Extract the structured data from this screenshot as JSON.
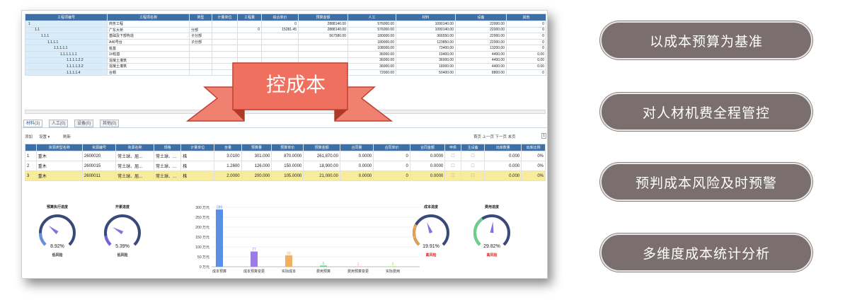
{
  "tree_table": {
    "headers": [
      "工程项编号",
      "工程项名称",
      "类型",
      "计量单位",
      "工程量",
      "综合单价",
      "预算金额",
      "人工",
      "材料",
      "设备",
      "其他"
    ],
    "rows": [
      {
        "code": "1",
        "name": "商务工程",
        "type": "",
        "unit": "",
        "qty": "",
        "price": "0",
        "budget": "2888140.00",
        "labor": "576000.00",
        "material": "1090140.00",
        "equip": "22000.00",
        "other": "0"
      },
      {
        "code": "1.1",
        "name": "广东大桥",
        "type": "分部",
        "unit": "",
        "qty": "0",
        "price": "15281.45",
        "budget": "2888140.00",
        "labor": "576000.00",
        "material": "1090140.00",
        "equip": "22000.00",
        "other": "0"
      },
      {
        "code": "1.1.1",
        "name": "基础及下部构造",
        "type": "子分部",
        "unit": "",
        "qty": "",
        "price": "",
        "budget": "567580.00",
        "labor": "180000.00",
        "material": "366550.00",
        "equip": "22000.00",
        "other": "0"
      },
      {
        "code": "1.1.1.1",
        "name": "A40号台",
        "type": "子分部",
        "unit": "",
        "qty": "",
        "price": "",
        "budget": "",
        "labor": "180000.00",
        "material": "123850.00",
        "equip": "22000.00",
        "other": "0"
      },
      {
        "code": "1.1.1.1.1",
        "name": "桩基",
        "type": "",
        "unit": "",
        "qty": "",
        "price": "",
        "budget": "",
        "labor": "108000.00",
        "material": "73400.00",
        "equip": "13200.00",
        "other": "0"
      },
      {
        "code": "1.1.1.1.1.1",
        "name": "1#桩基",
        "type": "",
        "unit": "",
        "qty": "",
        "price": "",
        "budget": "",
        "labor": "36000.00",
        "material": "19400.00",
        "equip": "4400.00",
        "other": "0.00"
      },
      {
        "code": "1.1.1.1.2.2",
        "name": "混凝土灌筑",
        "type": "",
        "unit": "",
        "qty": "",
        "price": "",
        "budget": "",
        "labor": "36000.00",
        "material": "36000.00",
        "equip": "4400.00",
        "other": "0.00"
      },
      {
        "code": "1.1.1.1.3.2",
        "name": "混凝土灌筑",
        "type": "",
        "unit": "",
        "qty": "",
        "price": "",
        "budget": "",
        "labor": "36000.00",
        "material": "18000.00",
        "equip": "4400.00",
        "other": "0.00"
      },
      {
        "code": "1.1.1.1.4",
        "name": "台帽",
        "type": "",
        "unit": "",
        "qty": "0",
        "price": "1312.",
        "budget": "",
        "labor": "72000.00",
        "material": "50400.00",
        "equip": "8800.00",
        "other": "0"
      }
    ]
  },
  "banner_text": "控成本",
  "tabs": [
    "材料(3)",
    "人工(0)",
    "设备(0)",
    "其他(0)"
  ],
  "toolbar": {
    "add": "添加",
    "settings": "设置 ▾",
    "refresh": "刷新",
    "pager": "首页 上一页 下一页 末页",
    "page": "1"
  },
  "resource_table": {
    "headers": [
      "",
      "资源类型名称",
      "资源编号",
      "资源名称",
      "规格",
      "计量单位",
      "含量",
      "预算量",
      "预算单价",
      "预算金额",
      "合同量",
      "合同单价",
      "合同金额",
      "甲供",
      "主设备",
      "出库数量",
      "出库比例"
    ],
    "rows": [
      {
        "n": "1",
        "type": "重木",
        "code": "2600020",
        "name": "常土球、屈...",
        "spec": "常土球、...",
        "unit": "株",
        "content": "3.0100",
        "qty": "301.000",
        "price": "870.0000",
        "amount": "261,870.00",
        "cqty": "0.0000",
        "cprice": "0",
        "camount": "0.0000",
        "out": "0.000",
        "ratio": "0%"
      },
      {
        "n": "2",
        "type": "重木",
        "code": "2600015",
        "name": "常土球、屈...",
        "spec": "常土球、...",
        "unit": "株",
        "content": "1.2600",
        "qty": "126.000",
        "price": "150.0000",
        "amount": "18,900.00",
        "cqty": "0.0000",
        "cprice": "0",
        "camount": "0.0000",
        "out": "0.000",
        "ratio": "0%"
      },
      {
        "n": "3",
        "type": "重木",
        "code": "2600011",
        "name": "常土球、屈...",
        "spec": "常土球、...",
        "unit": "株",
        "content": "2.0000",
        "qty": "200.000",
        "price": "105.0000",
        "amount": "21,000.00",
        "cqty": "0.0000",
        "cprice": "0",
        "camount": "0.0000",
        "out": "0.000",
        "ratio": "0%"
      }
    ]
  },
  "gauges": [
    {
      "title": "预算执行进度",
      "value": "8.92%",
      "risk": "低风险",
      "color": "#6a8fd8",
      "risk_color": "#333"
    },
    {
      "title": "开累进度",
      "value": "5.39%",
      "risk": "低风险",
      "color": "#7a5fd8",
      "risk_color": "#333"
    },
    {
      "title": "成本进度",
      "value": "19.91%",
      "risk": "高风险",
      "color": "#e0a050",
      "risk_color": "#e02020"
    },
    {
      "title": "费用进度",
      "value": "29.82%",
      "risk": "高风险",
      "color": "#6ad08a",
      "risk_color": "#e02020"
    }
  ],
  "chart_data": {
    "type": "bar",
    "categories": [
      "成本预算",
      "成本预算变更",
      "实际成本",
      "费用预算",
      "费用预算变更",
      "实际费用"
    ],
    "values": [
      289,
      77,
      58,
      6,
      1,
      2
    ],
    "colors": [
      "#5b8ee6",
      "#9b7be6",
      "#f0b060",
      "#70d090",
      "#f090b0",
      "#a0d860"
    ],
    "yticks": [
      "0 万元",
      "50 万元",
      "100 万元",
      "150 万元",
      "200 万元",
      "250 万元",
      "300 万元"
    ],
    "ylim": [
      0,
      300
    ]
  },
  "pills": [
    "以成本预算为基准",
    "对人材机费全程管控",
    "预判成本风险及时预警",
    "多维度成本统计分析"
  ]
}
